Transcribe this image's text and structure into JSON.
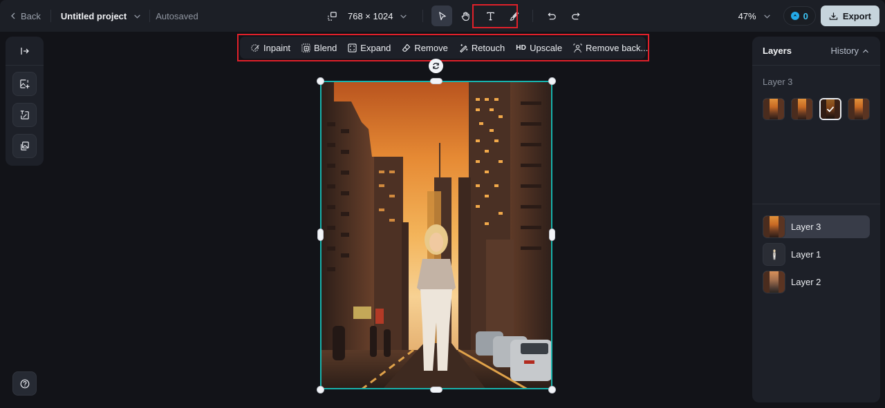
{
  "topbar": {
    "back_label": "Back",
    "project_name": "Untitled project",
    "save_status": "Autosaved",
    "canvas_size": "768 × 1024",
    "zoom_level": "47%",
    "credits": "0",
    "export_label": "Export"
  },
  "tools": {
    "resize": "resize-icon",
    "select": "pointer-icon",
    "pan": "hand-icon",
    "text": "text-icon",
    "brush": "brush-icon",
    "undo": "undo-icon",
    "redo": "redo-icon"
  },
  "image_tools": [
    {
      "label": "Inpaint",
      "icon": "inpaint-icon"
    },
    {
      "label": "Blend",
      "icon": "blend-icon"
    },
    {
      "label": "Expand",
      "icon": "expand-icon"
    },
    {
      "label": "Remove",
      "icon": "eraser-icon"
    },
    {
      "label": "Retouch",
      "icon": "magic-wand-icon"
    },
    {
      "label": "Upscale",
      "icon": "hd-icon",
      "prefix": "HD"
    },
    {
      "label": "Remove back...",
      "icon": "remove-background-icon"
    }
  ],
  "left_panel": {
    "items": [
      "expand-panel-icon",
      "add-image-icon",
      "text-to-image-icon",
      "layers-image-icon"
    ],
    "help": "help-icon"
  },
  "right_panel": {
    "title": "Layers",
    "history_label": "History",
    "history_layer": "Layer 3",
    "history_thumbs": [
      {
        "selected": false
      },
      {
        "selected": false
      },
      {
        "selected": true
      },
      {
        "selected": false
      }
    ],
    "layers": [
      {
        "name": "Layer 3",
        "active": true
      },
      {
        "name": "Layer 1",
        "active": false
      },
      {
        "name": "Layer 2",
        "active": false
      }
    ]
  },
  "colors": {
    "selection": "#17b3ad",
    "annotation": "#e0202a",
    "export_bg": "#c6d4dc",
    "credits_accent": "#3cc5f5"
  }
}
